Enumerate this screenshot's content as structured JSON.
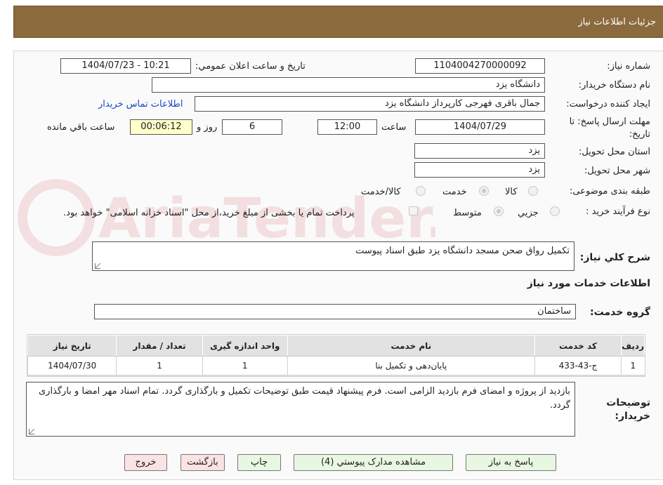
{
  "header": {
    "title": "جزئیات اطلاعات نیاز"
  },
  "form": {
    "need_number_label": "شماره نیاز:",
    "need_number": "1104004270000092",
    "announce_label": "تاريخ و ساعت اعلان عمومي:",
    "announce_value": "1404/07/23 - 10:21",
    "buyer_org_label": "نام دستگاه خريدار:",
    "buyer_org": "دانشگاه یزد",
    "requester_label": "ايجاد کننده درخواست:",
    "requester": "جمال باقری فهرجی کارپرداز دانشگاه یزد",
    "contact_link": "اطلاعات تماس خريدار",
    "deadline_label_1": "مهلت ارسال پاسخ: تا",
    "deadline_label_2": "تاريخ:",
    "deadline_date": "1404/07/29",
    "time_label": "ساعت",
    "deadline_time": "12:00",
    "days_value": "6",
    "days_label": "روز و",
    "remaining_time": "00:06:12",
    "remaining_label": "ساعت باقي مانده",
    "province_label": "استان محل تحويل:",
    "province": "یزد",
    "city_label": "شهر محل تحويل:",
    "city": "یزد",
    "category_label": "طبقه بندی موضوعی:",
    "category_options": [
      "کالا",
      "خدمت",
      "کالا/خدمت"
    ],
    "category_selected": "خدمت",
    "process_label": "نوع فرآيند خريد :",
    "process_options": [
      "جزيي",
      "متوسط"
    ],
    "process_selected": "متوسط",
    "payment_note": "پرداخت تمام يا بخشی از مبلغ خريد،از محل \"اسناد خزانه اسلامی\" خواهد بود.",
    "summary_label": "شرح کلي نياز:",
    "summary": "تکمیل رواق صحن مسجد دانشگاه یزد طبق اسناد پیوست",
    "services_heading": "اطلاعات خدمات مورد نياز",
    "service_group_label": "گروه خدمت:",
    "service_group": "ساختمان",
    "buyer_notes_label_1": "توضيحات",
    "buyer_notes_label_2": "خريدار:",
    "buyer_notes": "بازدید از پروژه و امضای فرم بازدید الزامی است. فرم پیشنهاد قیمت طبق توضیحات تکمیل و بارگذاری گردد. تمام اسناد مهر امضا و بارگذاری گردد."
  },
  "table": {
    "headers": [
      "رديف",
      "کد خدمت",
      "نام خدمت",
      "واحد اندازه گيری",
      "تعداد / مقدار",
      "تاريخ نياز"
    ],
    "rows": [
      [
        "1",
        "ج-43-433",
        "پایان‌دهی و تکمیل بنا",
        "1",
        "1",
        "1404/07/30"
      ]
    ]
  },
  "buttons": {
    "reply": "پاسخ به نياز",
    "attachments": "مشاهده مدارک پيوستي (4)",
    "print": "چاپ",
    "back": "بازگشت",
    "exit": "خروج"
  },
  "watermark": "AriaTender.neT",
  "colors": {
    "header_bg": "#8b6a3d",
    "link": "#1a46c8",
    "button_green": "#e8f7e1",
    "button_pink": "#fbe3e3",
    "timer_bg": "#ffffcc"
  }
}
